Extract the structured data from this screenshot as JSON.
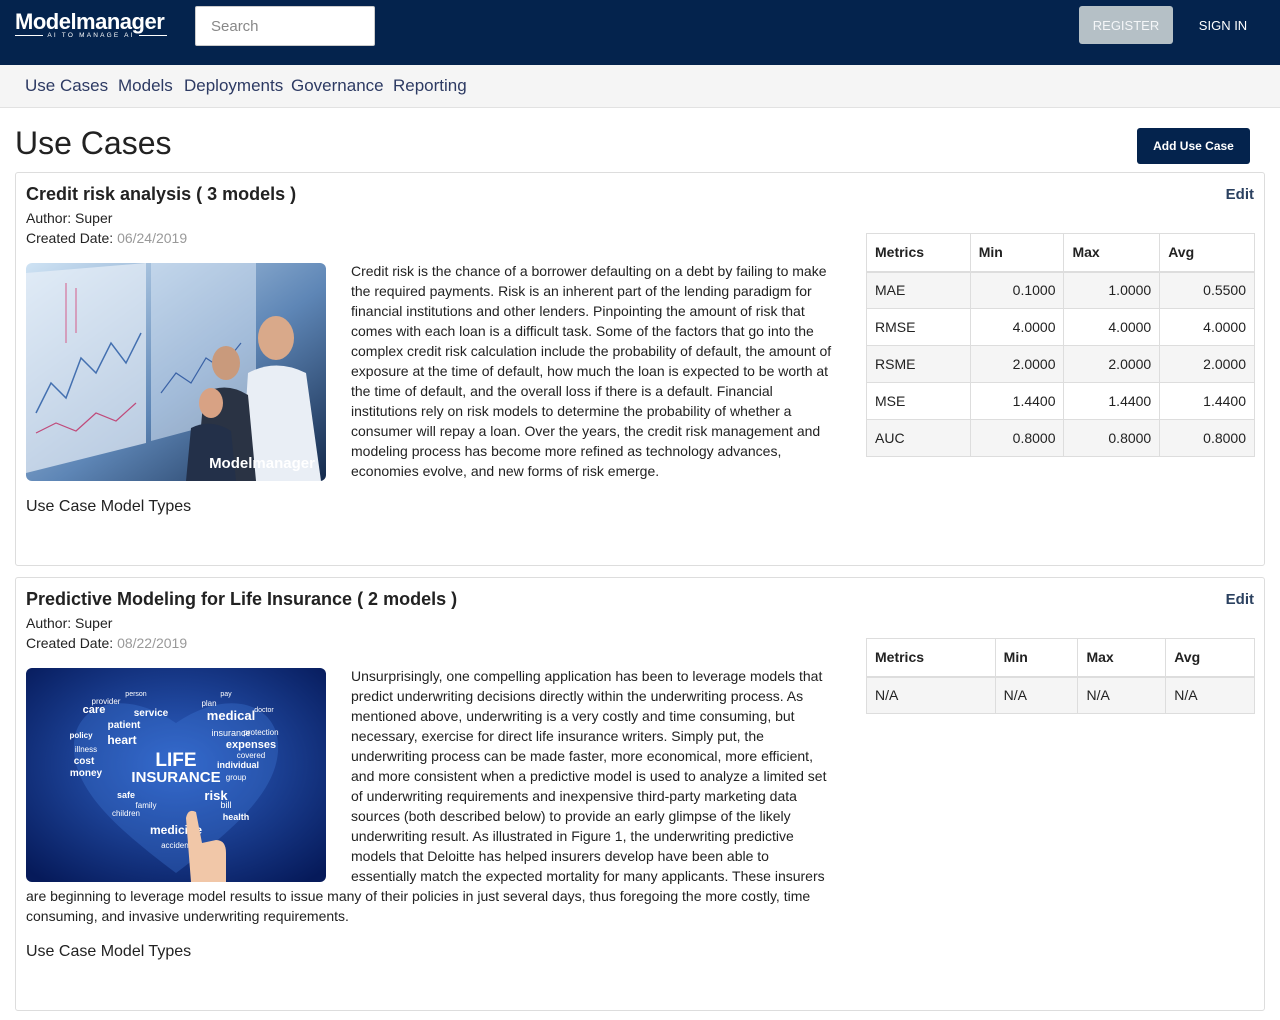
{
  "brand": {
    "name": "Modelmanager",
    "tagline": "AI TO MANAGE AI"
  },
  "header": {
    "search_placeholder": "Search",
    "register_label": "REGISTER",
    "signin_label": "SIGN IN"
  },
  "nav": {
    "items": [
      {
        "label": "Use Cases"
      },
      {
        "label": "Models"
      },
      {
        "label": "Deployments"
      },
      {
        "label": "Governance"
      },
      {
        "label": "Reporting"
      }
    ]
  },
  "page": {
    "title": "Use Cases",
    "add_button_label": "Add Use Case"
  },
  "use_cases": [
    {
      "title": "Credit risk analysis ( 3 models )",
      "edit_label": "Edit",
      "author_label": "Author: ",
      "author": "Super",
      "date_label": "Created Date: ",
      "created_date": "06/24/2019",
      "image_icon": "business-chart-photo",
      "image_watermark": "Modelmanager",
      "image_watermark_sub": "AI TO MANAGE AI",
      "description": "Credit risk is the chance of a borrower defaulting on a debt by failing to make the required payments. Risk is an inherent part of the lending paradigm for financial institutions and other lenders. Pinpointing the amount of risk that comes with each loan is a difficult task. Some of the factors that go into the complex credit risk calculation include the probability of default, the amount of exposure at the time of default, how much the loan is expected to be worth at the time of default, and the overall loss if there is a default. Financial institutions rely on risk models to determine the probability of whether a consumer will repay a loan. Over the years, the credit risk management and modeling process has become more refined as technology advances, economies evolve, and new forms of risk emerge.",
      "types_label": "Use Case Model Types",
      "metrics": {
        "headers": [
          "Metrics",
          "Min",
          "Max",
          "Avg"
        ],
        "rows": [
          [
            "MAE",
            "0.1000",
            "1.0000",
            "0.5500"
          ],
          [
            "RMSE",
            "4.0000",
            "4.0000",
            "4.0000"
          ],
          [
            "RSME",
            "2.0000",
            "2.0000",
            "2.0000"
          ],
          [
            "MSE",
            "1.4400",
            "1.4400",
            "1.4400"
          ],
          [
            "AUC",
            "0.8000",
            "0.8000",
            "0.8000"
          ]
        ]
      }
    },
    {
      "title": "Predictive Modeling for Life Insurance ( 2 models )",
      "edit_label": "Edit",
      "author_label": "Author: ",
      "author": "Super",
      "date_label": "Created Date: ",
      "created_date": "08/22/2019",
      "image_icon": "life-insurance-word-cloud",
      "image_words": [
        "LIFE",
        "INSURANCE",
        "medical",
        "heart",
        "care",
        "risk",
        "health",
        "medicine",
        "service",
        "patient",
        "expenses",
        "money",
        "cost",
        "individual",
        "policy",
        "accident",
        "protection",
        "bill",
        "illness",
        "group",
        "safe",
        "covered",
        "plan",
        "family",
        "insurance",
        "provider",
        "children",
        "doctor",
        "person",
        "pay"
      ],
      "description": "Unsurprisingly, one compelling application has been to leverage models that predict underwriting decisions directly within the underwriting process. As mentioned above, underwriting is a very costly and time consuming, but necessary, exercise for direct life insurance writers. Simply put, the underwriting process can be made faster, more economical, more efficient, and more consistent when a predictive model is used to analyze a limited set of underwriting requirements and inexpensive third-party marketing data sources (both described below) to provide an early glimpse of the likely underwriting result. As illustrated in Figure 1, the underwriting predictive models that Deloitte has helped insurers develop have been able to essentially match the expected mortality for many applicants. These insurers are beginning to leverage model results to issue many of their policies in just several days, thus foregoing the more costly, time consuming, and invasive underwriting requirements.",
      "types_label": "Use Case Model Types",
      "metrics": {
        "headers": [
          "Metrics",
          "Min",
          "Max",
          "Avg"
        ],
        "rows": [
          [
            "N/A",
            "N/A",
            "N/A",
            "N/A"
          ]
        ]
      }
    }
  ]
}
